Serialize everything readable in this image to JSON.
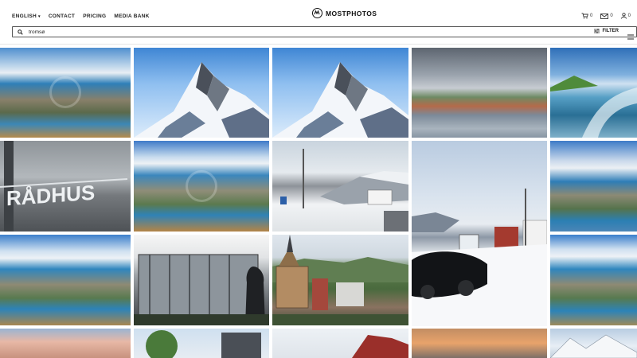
{
  "header": {
    "nav": {
      "language": "ENGLISH",
      "contact": "CONTACT",
      "pricing": "PRICING",
      "media_bank": "MEDIA BANK"
    },
    "logo_text": "MOSTPHOTOS",
    "cart_count": "0",
    "messages_count": "0",
    "profile_count": "0"
  },
  "search": {
    "value": "tromsø",
    "filter_label": "FILTER"
  },
  "icons": {
    "search": "search-icon",
    "filter": "sliders-icon",
    "menu": "hamburger-icon",
    "cart": "cart-icon",
    "mail": "mail-icon",
    "user": "user-icon"
  },
  "gallery": [
    {
      "subject": "aerial-city-fjord"
    },
    {
      "subject": "snowy-mountain-peak"
    },
    {
      "subject": "snowy-mountain-peak"
    },
    {
      "subject": "harbour-town-cloudy"
    },
    {
      "subject": "ship-wake-fjord"
    },
    {
      "subject": "radhus-building-sign"
    },
    {
      "subject": "aerial-city-bridge"
    },
    {
      "subject": "snowy-street-mountain"
    },
    {
      "subject": "snowy-road-car-bus"
    },
    {
      "subject": "aerial-city-fjord"
    },
    {
      "subject": "aerial-city-fjord"
    },
    {
      "subject": "glass-building-statue"
    },
    {
      "subject": "church-town-hill"
    },
    {
      "subject": "aerial-city-fjord"
    },
    {
      "subject": "sunset-mountains"
    },
    {
      "subject": "trees-buildings"
    },
    {
      "subject": "red-house-sky"
    },
    {
      "subject": "orange-clouds"
    },
    {
      "subject": "snowy-peaks"
    }
  ]
}
